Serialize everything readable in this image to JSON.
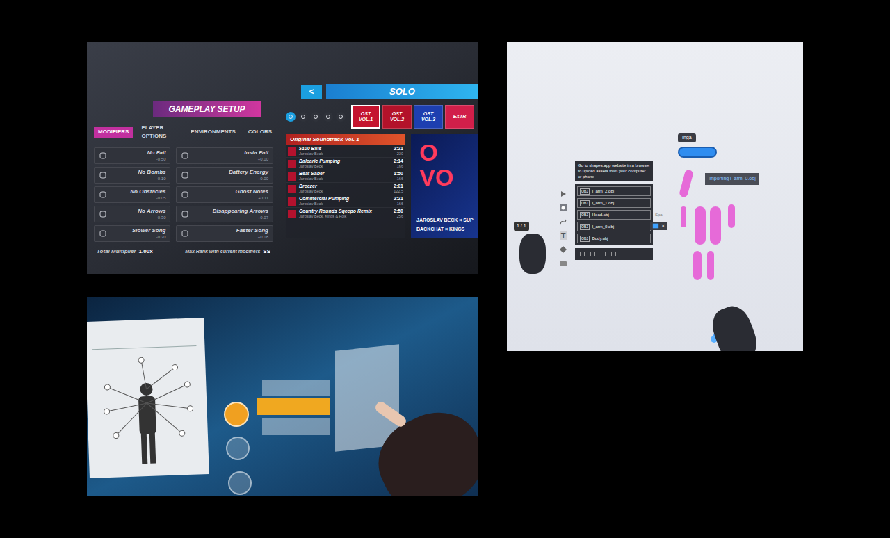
{
  "beat_saber": {
    "setup_title": "GAMEPLAY SETUP",
    "tabs": [
      {
        "label": "MODIFIERS",
        "selected": true
      },
      {
        "label": "PLAYER OPTIONS",
        "selected": false
      },
      {
        "label": "ENVIRONMENTS",
        "selected": false
      },
      {
        "label": "COLORS",
        "selected": false
      }
    ],
    "modifiers": [
      {
        "name": "No Fail",
        "value": "-0.50",
        "on": false
      },
      {
        "name": "No Bombs",
        "value": "-0.10",
        "on": false
      },
      {
        "name": "No Obstacles",
        "value": "-0.05",
        "on": false
      },
      {
        "name": "No Arrows",
        "value": "-0.30",
        "on": false
      },
      {
        "name": "Slower Song",
        "value": "-0.30",
        "on": false
      },
      {
        "name": "Insta Fail",
        "value": "+0.00",
        "on": false
      },
      {
        "name": "Battery Energy",
        "value": "+0.00",
        "on": false
      },
      {
        "name": "Ghost Notes",
        "value": "+0.11",
        "on": false
      },
      {
        "name": "Disappearing Arrows",
        "value": "+0.07",
        "on": false
      },
      {
        "name": "Faster Song",
        "value": "+0.08",
        "on": false
      }
    ],
    "total_label": "Total Multiplier",
    "total_value": "1.00x",
    "max_rank_label": "Max Rank with current modifiers",
    "max_rank_value": "SS",
    "back": "<",
    "mode_title": "SOLO",
    "category_filters": [
      {
        "selected": true
      },
      {
        "selected": false
      },
      {
        "selected": false
      },
      {
        "selected": false
      },
      {
        "selected": false
      }
    ],
    "packs": [
      {
        "label": "OST VOL.1",
        "selected": true,
        "color": "#c4142f"
      },
      {
        "label": "OST VOL.2",
        "selected": false,
        "color": "#b3122a"
      },
      {
        "label": "OST VOL.3",
        "selected": false,
        "color": "#1d3fb0"
      },
      {
        "label": "EXTR",
        "selected": false,
        "color": "#d11f4a"
      }
    ],
    "list_title": "Original Soundtrack Vol. 1",
    "songs": [
      {
        "title": "$100 Bills",
        "artist": "Jaroslav Beck",
        "duration": "2:21",
        "bpm": "230"
      },
      {
        "title": "Balearic Pumping",
        "artist": "Jaroslav Beck",
        "duration": "2:14",
        "bpm": "166"
      },
      {
        "title": "Beat Saber",
        "artist": "Jaroslav Beck",
        "duration": "1:50",
        "bpm": "166"
      },
      {
        "title": "Breezer",
        "artist": "Jaroslav Beck",
        "duration": "2:01",
        "bpm": "122.5"
      },
      {
        "title": "Commercial Pumping",
        "artist": "Jaroslav Beck",
        "duration": "2:21",
        "bpm": "166"
      },
      {
        "title": "Country Rounds Sqeepo Remix",
        "artist": "Jaroslav Beck, Kings & Folk",
        "duration": "2:50",
        "bpm": "256"
      }
    ],
    "cover_lines": [
      "O",
      "VO"
    ],
    "cover_credits": [
      "JAROSLAV BECK × SUP",
      "BACKCHAT × KINGS"
    ]
  },
  "shapes_app": {
    "page": "1 / 1",
    "text_tool": "T",
    "hint": "Go to shapes.app website in a browser to upload assets from your computer or phone",
    "files": [
      {
        "badge": "OBJ",
        "name": "l_arm_2.obj"
      },
      {
        "badge": "OBJ",
        "name": "l_arm_1.obj"
      },
      {
        "badge": "OBJ",
        "name": "Head.obj"
      },
      {
        "badge": "OBJ",
        "name": "l_arm_0.obj"
      },
      {
        "badge": "OBJ",
        "name": "Body.obj"
      }
    ],
    "cut_label": "Spa",
    "close": "×",
    "user": "Inga",
    "status": "Importing l_arm_0.obj"
  }
}
